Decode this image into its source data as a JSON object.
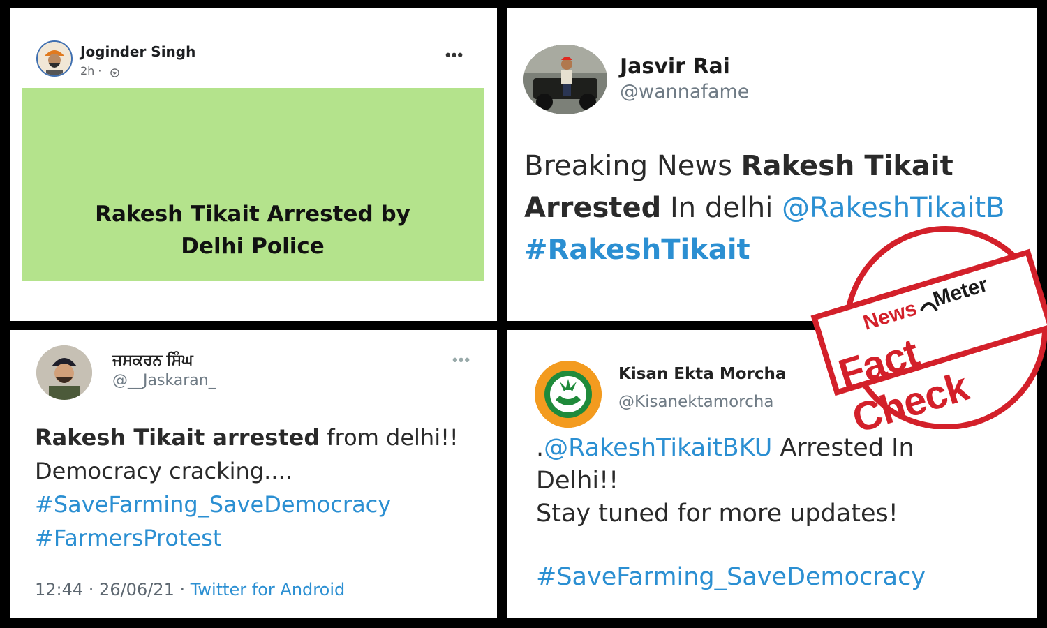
{
  "facebook_post": {
    "author": "Joginder Singh",
    "time": "2h ·",
    "more_icon": "ellipsis-icon",
    "card_line1": "Rakesh Tikait Arrested by",
    "card_line2": "Delhi Police",
    "card_color": "#b4e38c"
  },
  "tweet_jasvir": {
    "name": "Jasvir Rai",
    "handle": "@wannafame",
    "text_1": "Breaking News ",
    "text_2": "Rakesh Tikait",
    "text_3": "Arrested",
    "text_4": " In delhi ",
    "mention": "@RakeshTikaitB",
    "hashtag": "#RakeshTikait"
  },
  "tweet_jaskaran": {
    "name": "ਜਸਕਰਨ ਸਿੰਘ",
    "handle": "@__Jaskaran_",
    "text_bold": "Rakesh Tikait arrested",
    "text_rest": " from delhi!!",
    "line2": "Democracy cracking....",
    "hashtag1": "#SaveFarming_SaveDemocracy",
    "hashtag2": "#FarmersProtest",
    "timestamp": "12:44 · 26/06/21 · ",
    "source": "Twitter for Android"
  },
  "tweet_kisan": {
    "name": "Kisan Ekta Morcha",
    "handle": "@Kisanektamorcha",
    "dot": ".",
    "mention": "@RakeshTikaitBKU",
    "text_1": " Arrested In",
    "text_2": "Delhi!!",
    "text_3": "Stay tuned for more updates!",
    "hashtag": "#SaveFarming_SaveDemocracy",
    "logo_text": "KISAN EKTA MORCHA"
  },
  "stamp": {
    "brand_news": "News",
    "brand_meter": "Meter",
    "label": "Fact Check",
    "color": "#d3202a"
  },
  "colors": {
    "link": "#2b8fd2",
    "background": "#000000"
  }
}
